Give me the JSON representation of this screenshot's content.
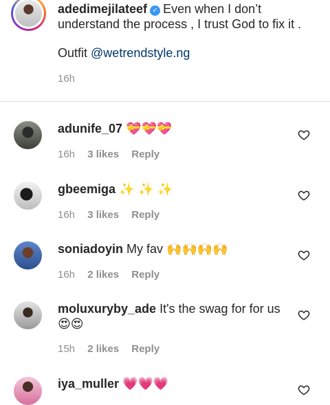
{
  "caption": {
    "username": "adedimejilateef",
    "text": "Even when I don’t understand the process , I trust God to fix it .",
    "outfit_label": "Outfit",
    "mention": "@wetrendstyle.ng",
    "time": "16h"
  },
  "comments": [
    {
      "username": "adunife_07",
      "text": "",
      "emoji": "💝💝💝",
      "time": "16h",
      "likes": "3 likes",
      "reply": "Reply"
    },
    {
      "username": "gbeemiga",
      "text": "",
      "emoji": "✨ ✨ ✨",
      "time": "16h",
      "likes": "3 likes",
      "reply": "Reply"
    },
    {
      "username": "soniadoyin",
      "text": "My fav",
      "emoji": "🙌🙌🙌🙌",
      "time": "16h",
      "likes": "2 likes",
      "reply": "Reply"
    },
    {
      "username": "moluxuryby_ade",
      "text": "It's the swag for for us",
      "emoji": "😍😍",
      "time": "15h",
      "likes": "2 likes",
      "reply": "Reply"
    },
    {
      "username": "iya_muller",
      "text": "",
      "emoji": "💗💗💗",
      "time": "",
      "likes": "",
      "reply": ""
    }
  ],
  "icons": {
    "verified": "verified-badge-icon",
    "like": "heart-outline-icon"
  },
  "colors": {
    "link": "#00376b",
    "verified": "#3897f0",
    "muted": "#8e8e8e"
  }
}
